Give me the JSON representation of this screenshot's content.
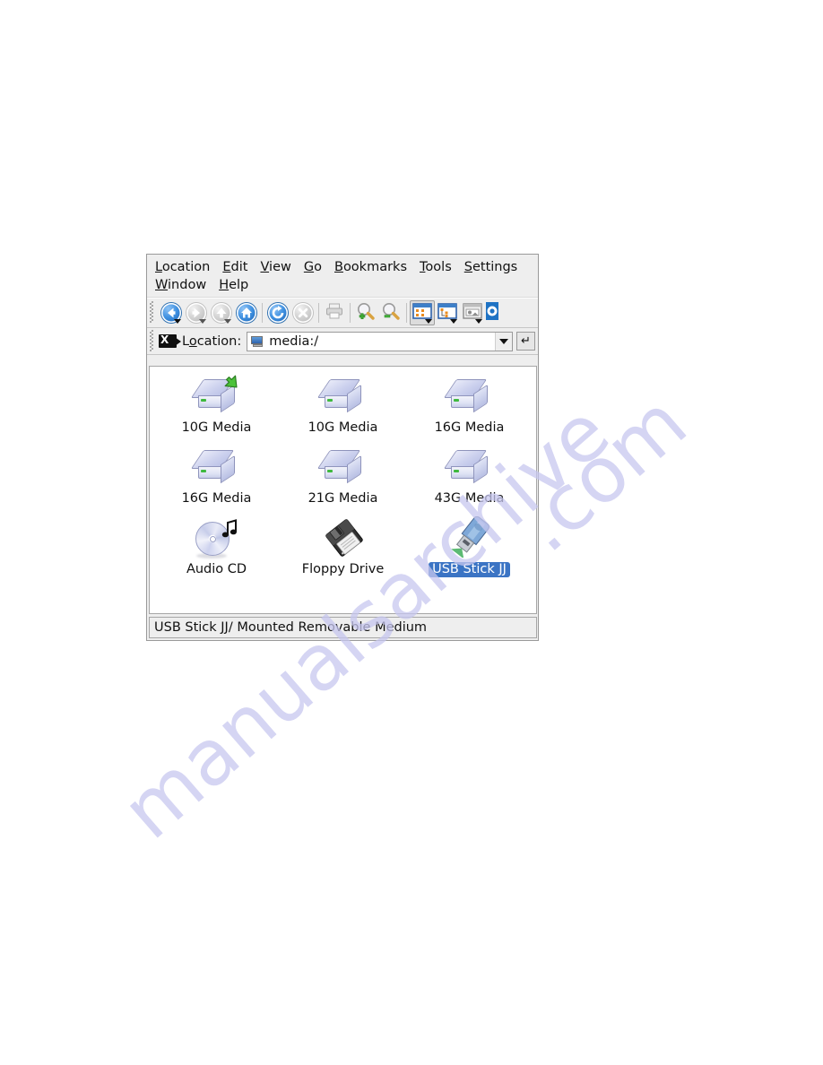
{
  "watermark": {
    "line1": "manualsarchive",
    "line2": ".com"
  },
  "window": {
    "menubar": {
      "row1": [
        {
          "pre": "L",
          "rest": "ocation",
          "name": "menu-location"
        },
        {
          "pre": "E",
          "rest": "dit",
          "name": "menu-edit"
        },
        {
          "pre": "V",
          "rest": "iew",
          "name": "menu-view"
        },
        {
          "pre": "G",
          "rest": "o",
          "name": "menu-go"
        },
        {
          "pre": "B",
          "rest": "ookmarks",
          "name": "menu-bookmarks"
        },
        {
          "pre": "T",
          "rest": "ools",
          "name": "menu-tools"
        },
        {
          "pre": "S",
          "rest": "ettings",
          "name": "menu-settings"
        }
      ],
      "row2": [
        {
          "pre": "W",
          "rest": "indow",
          "name": "menu-window"
        },
        {
          "pre": "H",
          "rest": "elp",
          "name": "menu-help"
        }
      ]
    },
    "toolbar": {
      "buttons": [
        {
          "icon": "back-icon",
          "label": "Back",
          "state": "enabled",
          "dropdown": true
        },
        {
          "icon": "forward-icon",
          "label": "Forward",
          "state": "disabled",
          "dropdown": true
        },
        {
          "icon": "up-icon",
          "label": "Up",
          "state": "disabled",
          "dropdown": true
        },
        {
          "icon": "home-icon",
          "label": "Home",
          "state": "enabled",
          "dropdown": false
        },
        {
          "icon": "reload-icon",
          "label": "Reload",
          "state": "enabled",
          "dropdown": false
        },
        {
          "icon": "stop-icon",
          "label": "Stop",
          "state": "disabled",
          "dropdown": false
        },
        {
          "icon": "print-icon",
          "label": "Print",
          "state": "disabled",
          "dropdown": false
        },
        {
          "icon": "zoom-in-icon",
          "label": "Increase Font Sizes",
          "state": "enabled",
          "dropdown": false
        },
        {
          "icon": "zoom-out-icon",
          "label": "Decrease Font Sizes",
          "state": "enabled",
          "dropdown": false
        },
        {
          "icon": "icon-view-icon",
          "label": "Icon View",
          "state": "pressed",
          "dropdown": true
        },
        {
          "icon": "tree-view-icon",
          "label": "Tree View",
          "state": "enabled",
          "dropdown": true
        },
        {
          "icon": "preview-view-icon",
          "label": "Preview",
          "state": "enabled",
          "dropdown": true
        },
        {
          "icon": "configure-icon",
          "label": "Configure",
          "state": "enabled",
          "dropdown": false
        }
      ]
    },
    "location_bar": {
      "clear_icon": "clear-location-icon",
      "label_pre": "L",
      "label_accel": "o",
      "label_rest": "cation:",
      "value": "media:/",
      "placeholder": "",
      "value_icon": "monitor-icon",
      "dropdown_icon": "chevron-down-icon",
      "go_icon": "go-enter-icon",
      "go_glyph": "↵"
    },
    "icon_view": {
      "items": [
        {
          "label": "10G Media",
          "icon": "hard-disk-icon",
          "mounted": true,
          "selected": false
        },
        {
          "label": "10G Media",
          "icon": "hard-disk-icon",
          "mounted": false,
          "selected": false
        },
        {
          "label": "16G Media",
          "icon": "hard-disk-icon",
          "mounted": false,
          "selected": false
        },
        {
          "label": "16G Media",
          "icon": "hard-disk-icon",
          "mounted": false,
          "selected": false
        },
        {
          "label": "21G Media",
          "icon": "hard-disk-icon",
          "mounted": false,
          "selected": false
        },
        {
          "label": "43G Media",
          "icon": "hard-disk-icon",
          "mounted": false,
          "selected": false
        },
        {
          "label": "Audio CD",
          "icon": "audio-cd-icon",
          "mounted": false,
          "selected": false
        },
        {
          "label": "Floppy Drive",
          "icon": "floppy-disk-icon",
          "mounted": false,
          "selected": false
        },
        {
          "label": "USB Stick JJ",
          "icon": "usb-stick-icon",
          "mounted": true,
          "selected": true
        }
      ]
    },
    "status_bar": {
      "text": "USB Stick JJ/  Mounted Removable Medium"
    }
  },
  "colors": {
    "selection_blue": "#3b74c4",
    "toolbar_blue": "#3d8fe0",
    "led_green": "#3fb93f",
    "mount_badge_green": "#4cc23a",
    "window_bg": "#eeeeee",
    "view_bg": "#ffffff",
    "watermark": "#c7c7ef"
  }
}
